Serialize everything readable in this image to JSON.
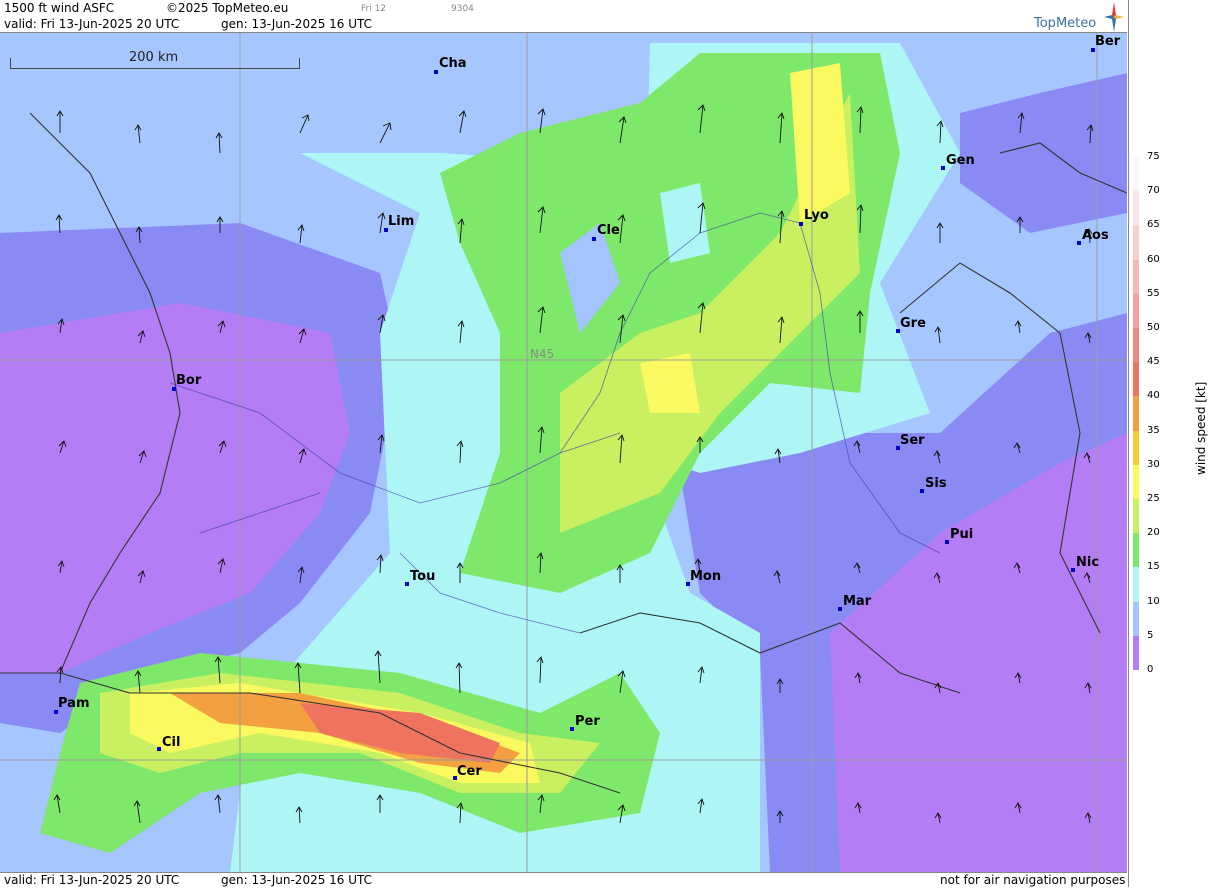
{
  "header": {
    "title": "1500 ft wind ASFC",
    "copyright": "©2025 TopMeteo.eu",
    "day": "Fri 12",
    "code": "9304",
    "valid": "valid:  Fri  13-Jun-2025  20 UTC",
    "generated": "gen: 13-Jun-2025 16 UTC",
    "logo": "TopMeteo"
  },
  "footer": {
    "valid": "valid:  Fri  13-Jun-2025  20 UTC",
    "generated": "gen: 13-Jun-2025 16 UTC",
    "disclaimer": "not for air navigation purposes"
  },
  "map": {
    "scale_label": "200 km",
    "latitude_label": "N45",
    "cities": [
      {
        "code": "Cha"
      },
      {
        "code": "Ber"
      },
      {
        "code": "Gen"
      },
      {
        "code": "Lim"
      },
      {
        "code": "Cle"
      },
      {
        "code": "Lyo"
      },
      {
        "code": "Aos"
      },
      {
        "code": "Gre"
      },
      {
        "code": "Bor"
      },
      {
        "code": "Ser"
      },
      {
        "code": "Sis"
      },
      {
        "code": "Pui"
      },
      {
        "code": "Tou"
      },
      {
        "code": "Mon"
      },
      {
        "code": "Mar"
      },
      {
        "code": "Nic"
      },
      {
        "code": "Pam"
      },
      {
        "code": "Per"
      },
      {
        "code": "Cil"
      },
      {
        "code": "Cer"
      }
    ],
    "wind_direction": "southerly to south-southeasterly"
  },
  "legend": {
    "unit": "wind  speed  [kt]",
    "ticks": [
      "75",
      "70",
      "65",
      "60",
      "55",
      "50",
      "45",
      "40",
      "35",
      "30",
      "25",
      "20",
      "15",
      "10",
      "5",
      "0"
    ],
    "colors": [
      "#fbf6f6",
      "#fbe4e4",
      "#f8cfcf",
      "#f5b8b8",
      "#f3a0a0",
      "#f08a80",
      "#ef7460",
      "#f2a040",
      "#f7cc30",
      "#fafa60",
      "#c8f060",
      "#7ee86a",
      "#aef5f5",
      "#a3c4ff",
      "#8a8af5",
      "#b47cf5"
    ]
  },
  "colors": {
    "calm": "#b47cf5",
    "light": "#8a8af5",
    "moderate": "#a3c4ff",
    "fresh": "#aef5f5",
    "strong": "#7ee86a",
    "gale": "#fafa60",
    "storm": "#ef7460"
  }
}
